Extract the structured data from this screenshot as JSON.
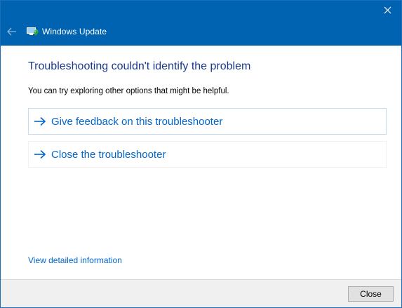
{
  "window": {
    "title": "Windows Update",
    "icon": "windows-update-icon",
    "back_icon": "back-arrow-icon",
    "close_icon": "close-icon"
  },
  "main": {
    "heading": "Troubleshooting couldn't identify the problem",
    "subtext": "You can try exploring other options that might be helpful.",
    "options": [
      {
        "label": "Give feedback on this troubleshooter",
        "icon": "arrow-right-icon"
      },
      {
        "label": "Close the troubleshooter",
        "icon": "arrow-right-icon"
      }
    ],
    "details_link": "View detailed information"
  },
  "footer": {
    "close_label": "Close"
  },
  "colors": {
    "titlebar": "#0063b1",
    "heading": "#1a3a8f",
    "link": "#0066cc",
    "footer": "#f0f0f0"
  }
}
